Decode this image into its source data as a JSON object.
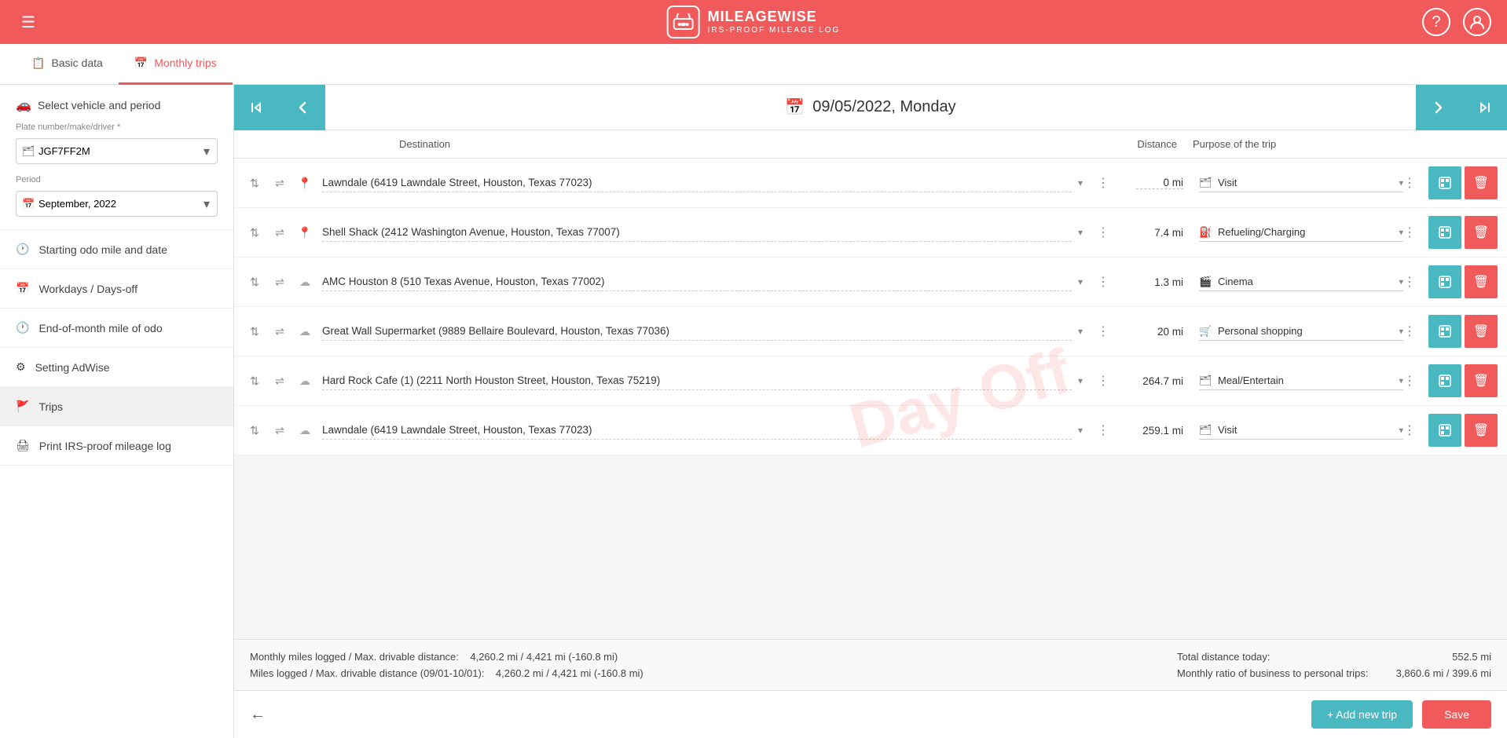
{
  "header": {
    "brand": "MILEAGEWISE",
    "sub": "IRS-PROOF MILEAGE LOG",
    "menu_icon": "☰",
    "help_icon": "?",
    "user_icon": "👤"
  },
  "tabs": [
    {
      "id": "basic-data",
      "label": "Basic data",
      "icon": "📋",
      "active": false
    },
    {
      "id": "monthly-trips",
      "label": "Monthly trips",
      "icon": "📅",
      "active": true
    }
  ],
  "sidebar": {
    "select_vehicle_label": "Select vehicle and period",
    "plate_label": "Plate number/make/driver *",
    "plate_value": "JGF7FF2M",
    "period_label": "Period",
    "period_value": "September, 2022",
    "items": [
      {
        "id": "starting-odo",
        "label": "Starting odo mile and date",
        "icon": "🕐"
      },
      {
        "id": "workdays",
        "label": "Workdays / Days-off",
        "icon": "📅"
      },
      {
        "id": "end-of-month",
        "label": "End-of-month mile of odo",
        "icon": "🕐"
      },
      {
        "id": "setting-adwise",
        "label": "Setting AdWise",
        "icon": "⚙"
      },
      {
        "id": "trips",
        "label": "Trips",
        "icon": "🚩",
        "active": true
      },
      {
        "id": "print",
        "label": "Print IRS-proof mileage log",
        "icon": "🖨"
      }
    ]
  },
  "date_nav": {
    "date": "09/05/2022, Monday"
  },
  "table": {
    "col_destination": "Destination",
    "col_distance": "Distance",
    "col_purpose": "Purpose of the trip"
  },
  "trips": [
    {
      "id": 1,
      "destination": "Lawndale (6419 Lawndale Street, Houston, Texas 77023)",
      "distance": "0 mi",
      "distance_dashed": true,
      "purpose": "Visit",
      "purpose_icon": "🗂"
    },
    {
      "id": 2,
      "destination": "Shell Shack (2412 Washington Avenue, Houston, Texas 77007)",
      "distance": "7.4 mi",
      "distance_dashed": false,
      "purpose": "Refueling/Charging",
      "purpose_icon": "⛽"
    },
    {
      "id": 3,
      "destination": "AMC Houston 8 (510 Texas Avenue, Houston, Texas 77002)",
      "distance": "1.3 mi",
      "distance_dashed": false,
      "purpose": "Cinema",
      "purpose_icon": "🎬"
    },
    {
      "id": 4,
      "destination": "Great Wall Supermarket (9889 Bellaire Boulevard, Houston, Texas 77036)",
      "distance": "20 mi",
      "distance_dashed": false,
      "purpose": "Personal shopping",
      "purpose_icon": "🛒"
    },
    {
      "id": 5,
      "destination": "Hard Rock Cafe (1) (2211 North Houston Street, Houston, Texas 75219)",
      "distance": "264.7 mi",
      "distance_dashed": false,
      "purpose": "Meal/Entertain",
      "purpose_icon": "🗂"
    },
    {
      "id": 6,
      "destination": "Lawndale (6419 Lawndale Street, Houston, Texas 77023)",
      "distance": "259.1 mi",
      "distance_dashed": false,
      "purpose": "Visit",
      "purpose_icon": "🗂"
    }
  ],
  "watermark": "Day Off",
  "footer": {
    "label_monthly": "Monthly miles logged / Max. drivable distance:",
    "value_monthly": "4,260.2 mi / 4,421 mi (-160.8 mi)",
    "label_miles": "Miles logged / Max. drivable distance (09/01-10/01):",
    "value_miles": "4,260.2 mi / 4,421 mi (-160.8 mi)",
    "label_total": "Total distance today:",
    "value_total": "552.5 mi",
    "label_ratio": "Monthly ratio of business to personal trips:",
    "value_ratio": "3,860.6 mi / 399.6 mi"
  },
  "actions": {
    "back_icon": "←",
    "add_trip": "+ Add new trip",
    "save": "Save"
  }
}
